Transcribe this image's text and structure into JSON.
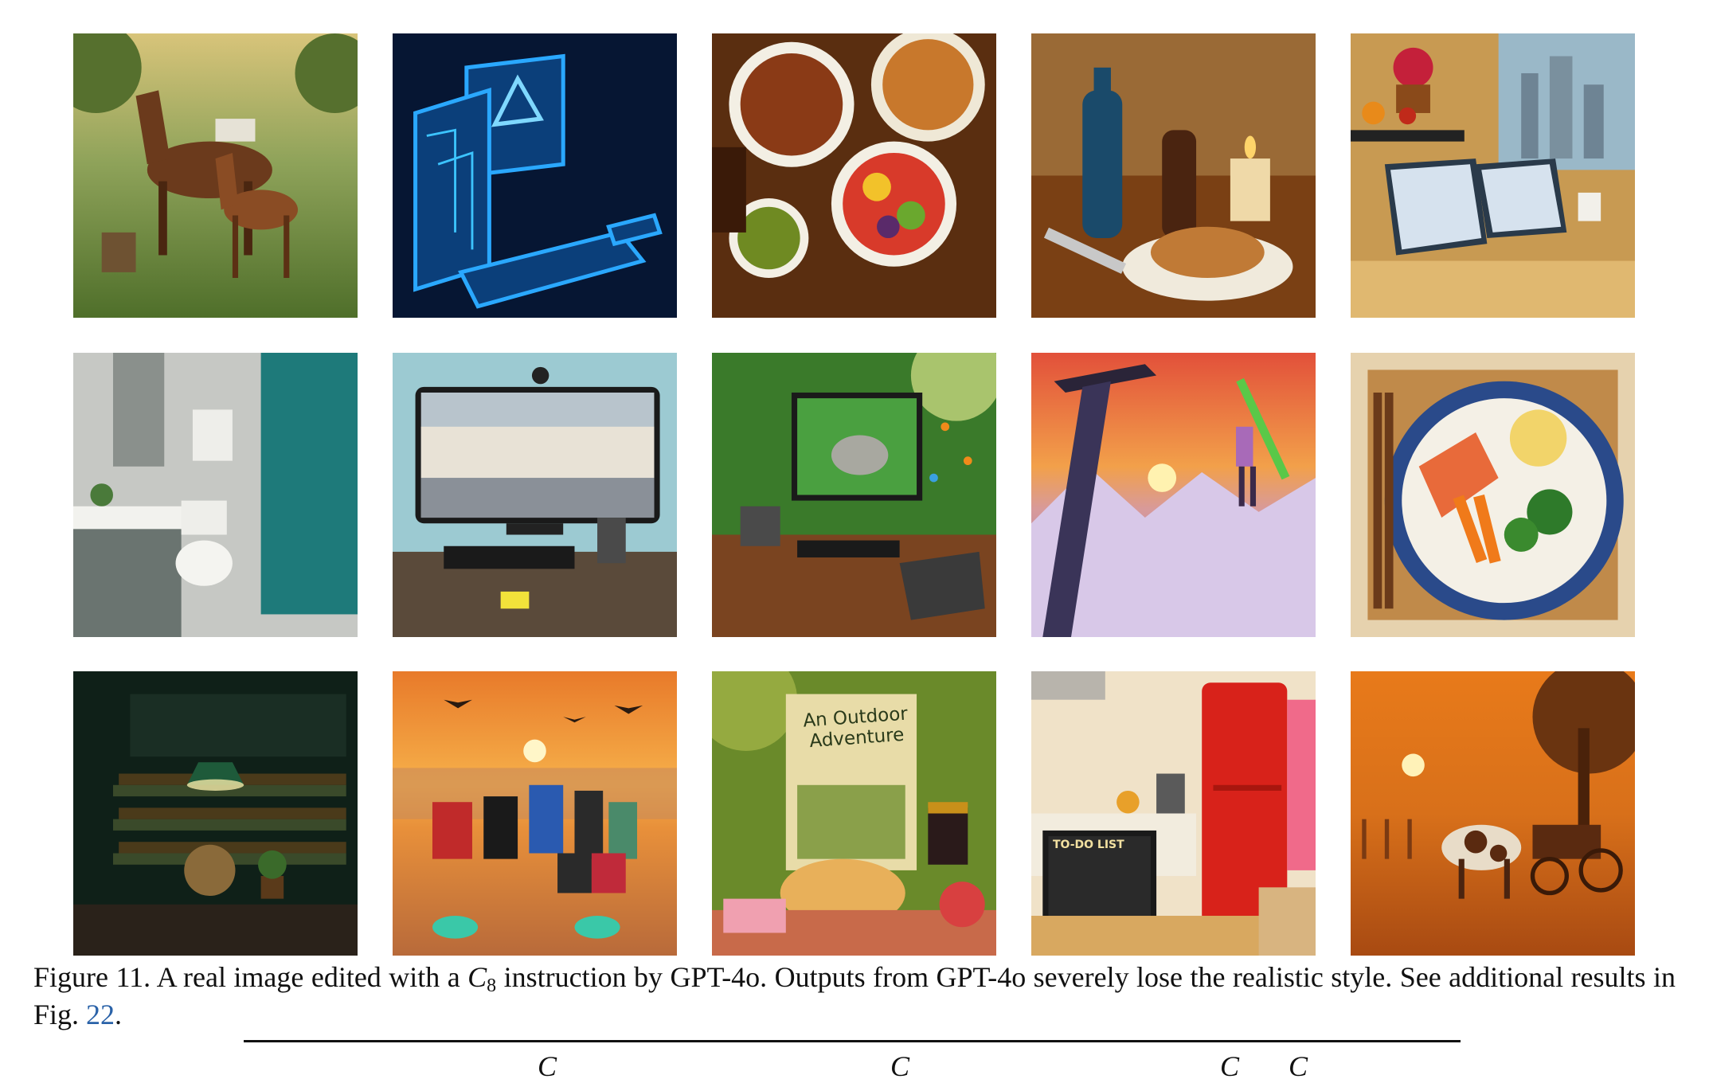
{
  "figure": {
    "label": "Figure 11.",
    "text_before_math": "A real image edited with a",
    "math_symbol": "C",
    "math_subscript": "8",
    "text_after_math": "instruction by GPT-4o. Outputs from GPT-4o severely lose the realistic style. See additional results in Fig.",
    "ref_number": "22",
    "end_punct": "."
  },
  "table_header_fragment": {
    "col1": "C",
    "col2": "C",
    "col3": "C",
    "col4": "C"
  },
  "tiles": [
    {
      "name": "horses-meadow-image"
    },
    {
      "name": "neon-computer-image"
    },
    {
      "name": "food-bowls-image"
    },
    {
      "name": "bottle-bread-candle-image"
    },
    {
      "name": "laptops-window-image"
    },
    {
      "name": "bathroom-image"
    },
    {
      "name": "monitor-square-image"
    },
    {
      "name": "forest-monitor-elephant-image"
    },
    {
      "name": "ice-axe-climber-image"
    },
    {
      "name": "salmon-plate-image"
    },
    {
      "name": "wine-cellar-globe-image"
    },
    {
      "name": "beach-group-sunset-image"
    },
    {
      "name": "outdoor-adventure-book-puppy-image",
      "book_title_line1": "An Outdoor",
      "book_title_line2": "Adventure"
    },
    {
      "name": "kitchen-red-fridge-image",
      "screen_title": "TO-DO LIST"
    },
    {
      "name": "cow-cart-sunset-image"
    }
  ]
}
